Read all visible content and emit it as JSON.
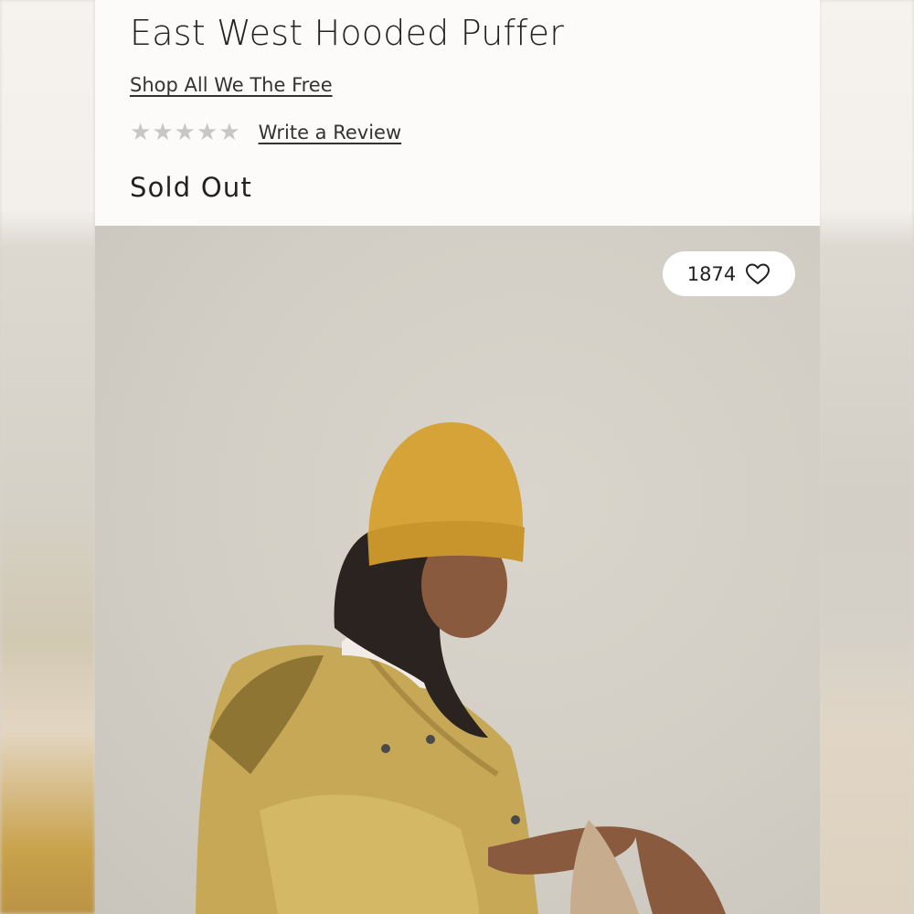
{
  "product": {
    "title": "East West Hooded Puffer",
    "brand_link": "Shop All We The Free",
    "rating": {
      "stars_filled": 0,
      "stars_total": 5,
      "review_link": "Write a Review"
    },
    "stock_status": "Sold Out"
  },
  "image": {
    "favorite_count": "1874",
    "favorite_icon": "heart-outline-icon"
  },
  "colors": {
    "panel_background": "#fdfbfa",
    "image_background": "#d4d0c7",
    "star_empty": "#c9c7c5",
    "text": "#222222"
  }
}
